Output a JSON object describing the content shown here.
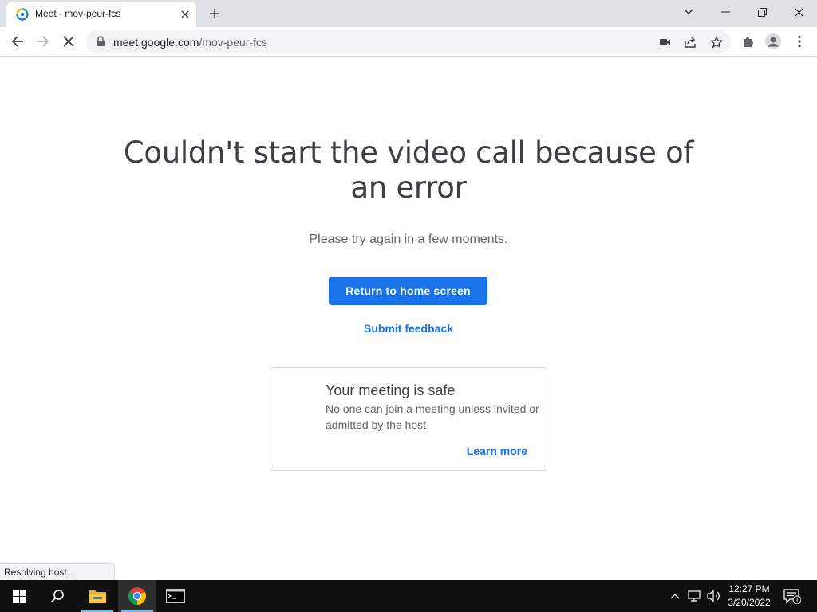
{
  "browser": {
    "tab": {
      "title": "Meet - mov-peur-fcs"
    },
    "url": {
      "host": "meet.google.com",
      "path": "/mov-peur-fcs"
    },
    "status": "Resolving host..."
  },
  "page": {
    "headline": "Couldn't start the video call because of an error",
    "subtext": "Please try again in a few moments.",
    "primary_button": "Return to home screen",
    "feedback_link": "Submit feedback",
    "card": {
      "title": "Your meeting is safe",
      "description": "No one can join a meeting unless invited or admitted by the host",
      "link": "Learn more"
    }
  },
  "taskbar": {
    "time": "12:27 PM",
    "date": "3/20/2022",
    "notification_count": "1"
  },
  "colors": {
    "accent": "#1a73e8",
    "taskbar": "#101010",
    "tabstrip": "#dee1e6"
  }
}
